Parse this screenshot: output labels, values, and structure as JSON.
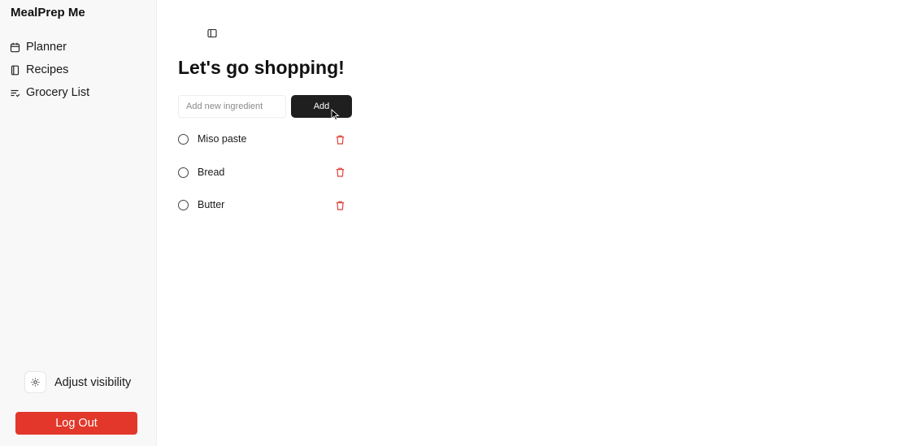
{
  "app": {
    "title": "MealPrep Me"
  },
  "sidebar": {
    "items": [
      {
        "label": "Planner",
        "icon": "calendar-icon"
      },
      {
        "label": "Recipes",
        "icon": "book-icon"
      },
      {
        "label": "Grocery List",
        "icon": "list-icon"
      }
    ],
    "visibility": {
      "label": "Adjust visibility",
      "icon": "sun-icon"
    },
    "logout_label": "Log Out"
  },
  "main": {
    "title": "Let's go shopping!",
    "input": {
      "placeholder": "Add new ingredient",
      "value": ""
    },
    "add_label": "Add",
    "items": [
      {
        "name": "Miso paste",
        "checked": false
      },
      {
        "name": "Bread",
        "checked": false
      },
      {
        "name": "Butter",
        "checked": false
      }
    ]
  },
  "colors": {
    "accent_red": "#e2372a",
    "delete_icon": "#e0453a",
    "add_button": "#1f1f1f",
    "sidebar_bg": "#f8f8f8"
  }
}
